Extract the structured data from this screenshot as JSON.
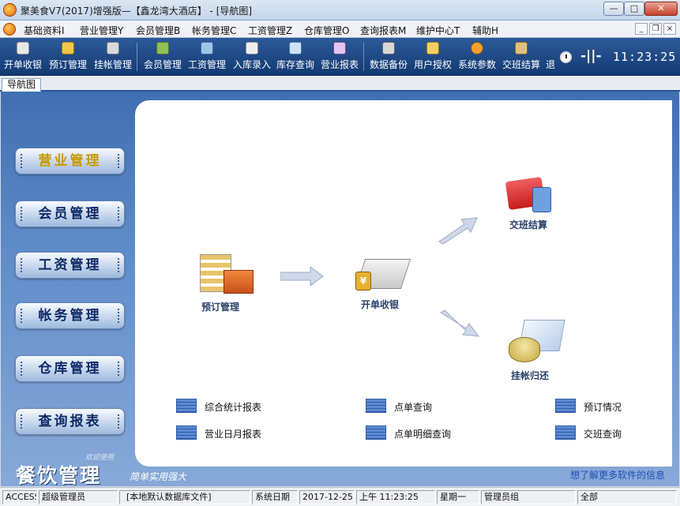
{
  "window": {
    "title": "聚美食V7(2017)增强版—【鑫龙湾大酒店】 - [导航图]",
    "minimize": "—",
    "maximize": "□",
    "close": "✕"
  },
  "menu": {
    "items": [
      "基础资料I",
      "营业管理Y",
      "会员管理B",
      "帐务管理C",
      "工资管理Z",
      "仓库管理O",
      "查询报表M",
      "维护中心T",
      "辅助H"
    ],
    "mdi_min": "_",
    "mdi_restore": "❐",
    "mdi_close": "×"
  },
  "toolbar": {
    "buttons": [
      "开单收银",
      "预订管理",
      "挂帐管理",
      "会员管理",
      "工资管理",
      "入库录入",
      "库存查询",
      "营业报表",
      "数据备份",
      "用户授权",
      "系统参数",
      "交班结算",
      "退"
    ],
    "clock_mark": "‑||‑",
    "time": "11:23:25"
  },
  "tab": {
    "label": "导航图"
  },
  "left_nav": [
    "营业管理",
    "会员管理",
    "工资管理",
    "帐务管理",
    "仓库管理",
    "查询报表"
  ],
  "flow": {
    "reserve": "预订管理",
    "checkout": "开单收银",
    "shift": "交班结算",
    "credit": "挂帐归还"
  },
  "reports": [
    "综合统计报表",
    "点单查询",
    "预订情况",
    "营业日月报表",
    "点单明细查询",
    "交班查询"
  ],
  "brand": {
    "title": "餐饮管理",
    "subtitle": "简单实用强大",
    "small": "欢迎使用"
  },
  "more_link": "想了解更多软件的信息",
  "status": {
    "db": "ACCESS",
    "user": "超级管理员",
    "datasource": "[本地默认数据库文件]",
    "date_label": "系统日期",
    "date": "2017-12-25",
    "ampm": "上午",
    "time": "11:23:25",
    "weekday": "星期一",
    "group": "管理员组",
    "scope": "全部"
  },
  "colors": {
    "toolbar": "#1e4a87",
    "active_nav": "#c79b00",
    "panel_bg": "#ffffff"
  }
}
